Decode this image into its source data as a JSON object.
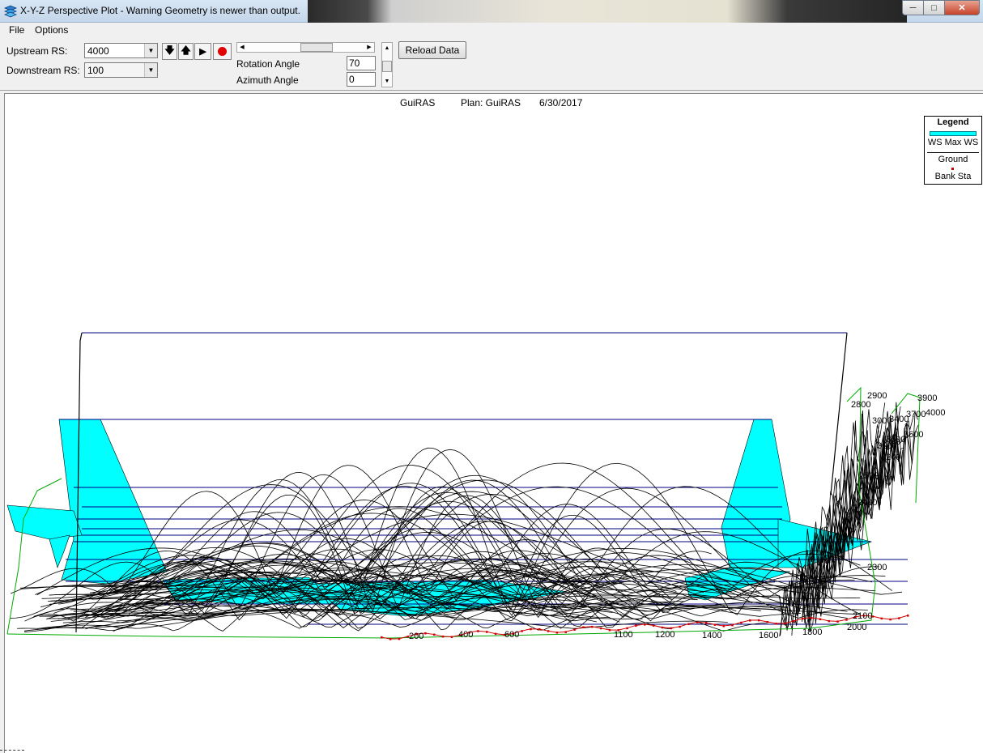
{
  "window": {
    "title": "X-Y-Z Perspective Plot - Warning Geometry is newer than output.",
    "icon": "stacked-layers-icon"
  },
  "menu": {
    "file": "File",
    "options": "Options"
  },
  "toolbar": {
    "upstream_label": "Upstream RS:",
    "upstream_value": "4000",
    "downstream_label": "Downstream RS:",
    "downstream_value": "100",
    "rotation_label": "Rotation Angle",
    "rotation_value": "70",
    "azimuth_label": "Azimuth Angle",
    "azimuth_value": "0",
    "reload_label": "Reload Data",
    "slider_position": 0.62
  },
  "plot": {
    "title_name": "GuiRAS",
    "title_plan": "Plan: GuiRAS",
    "title_date": "6/30/2017",
    "legend": {
      "title": "Legend",
      "items": [
        "WS Max WS",
        "Ground",
        "Bank Sta"
      ],
      "colors": {
        "ws": "#00ffff",
        "ground": "#000000",
        "bank": "#d00000",
        "outline": "#00aa00",
        "level_lines": "#000080"
      }
    },
    "station_labels_bottom": [
      "200",
      "400",
      "600",
      "1100",
      "1200",
      "1400",
      "1600",
      "1800",
      "2000",
      "2100"
    ],
    "station_labels_right": [
      "2900",
      "2800",
      "3900",
      "4000",
      "3000",
      "3400",
      "3700",
      "3600",
      "3100",
      "3500",
      "3200",
      "2400",
      "2300",
      "2500"
    ]
  }
}
